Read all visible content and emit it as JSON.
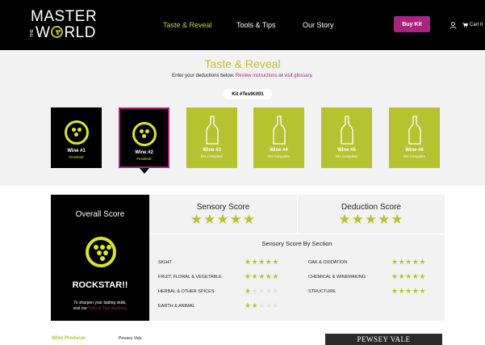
{
  "header": {
    "logo_line1": "MASTER",
    "logo_the": "THE",
    "logo_line2_pre": "W",
    "logo_line2_post": "RLD",
    "nav": [
      {
        "label": "Taste & Reveal",
        "active": true
      },
      {
        "label": "Tools & Tips",
        "active": false
      },
      {
        "label": "Our Story",
        "active": false
      }
    ],
    "buy_label": "Buy Kit",
    "cart_label": "Cart 0"
  },
  "taste": {
    "title": "Taste & Reveal",
    "subtitle_pre": "Enter your deductions below. ",
    "review_link": "Review instructions",
    "subtitle_mid": " or ",
    "glossary_link": "visit glossary",
    "subtitle_post": ".",
    "kit_label": "Kit #TestKit01",
    "wines": [
      {
        "name": "Wine #1",
        "status": "Finished!",
        "kind": "finished"
      },
      {
        "name": "Wine #2",
        "status": "Finished!",
        "kind": "finished"
      },
      {
        "name": "Wine #3",
        "status": "0% Complete",
        "kind": "pending"
      },
      {
        "name": "Wine #4",
        "status": "0% Complete",
        "kind": "pending"
      },
      {
        "name": "Wine #5",
        "status": "0% Complete",
        "kind": "pending"
      },
      {
        "name": "Wine #6",
        "status": "0% Complete",
        "kind": "pending"
      }
    ],
    "selected_index": 1
  },
  "overall": {
    "title": "Overall Score",
    "rating": "ROCKSTAR!!",
    "tip_line1": "To sharpen your tasting skills,",
    "tip_pre": "visit our ",
    "tip_link": "Tools & Tips sections",
    "tip_post": "."
  },
  "scores": {
    "sensory_title": "Sensory Score",
    "sensory_stars": 5,
    "deduction_title": "Deduction Score",
    "deduction_stars": 5,
    "by_section_title": "Sensory Score By Section",
    "sections": [
      {
        "label": "SIGHT",
        "stars": 5
      },
      {
        "label": "FRUIT, FLORAL & VEGETABLE",
        "stars": 5
      },
      {
        "label": "HERBAL & OTHER SPICES",
        "stars": 1
      },
      {
        "label": "EARTH & ANIMAL",
        "stars": 2
      },
      {
        "label": "OAK & OXIDATION",
        "stars": 5
      },
      {
        "label": "CHEMICAL & WINEMAKING",
        "stars": 5
      },
      {
        "label": "STRUCTURE",
        "stars": 5
      }
    ]
  },
  "producer": {
    "label": "Wine Producer",
    "value": "Pewsey Vale",
    "brand": "PEWSEY VALE"
  },
  "colors": {
    "accent_green": "#b5c330",
    "accent_purple": "#a8247e",
    "badge_yellow": "#d9e62f"
  },
  "icons": {
    "user": "user-icon",
    "cart": "cart-icon",
    "bottle": "wine-bottle-icon",
    "grape": "grape-badge-icon"
  }
}
